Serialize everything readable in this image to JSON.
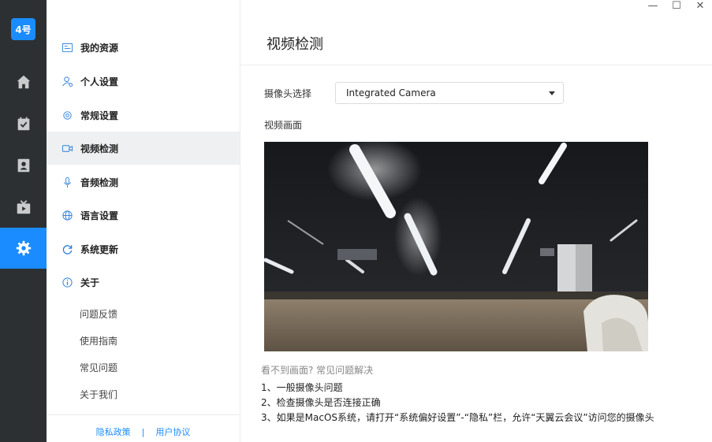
{
  "app": {
    "logo_text": "4号",
    "accent_color": "#1a8cff",
    "rail_bg": "#2d3033",
    "rail_items": [
      {
        "icon": "home-icon",
        "active": false
      },
      {
        "icon": "calendar-check-icon",
        "active": false
      },
      {
        "icon": "contacts-icon",
        "active": false
      },
      {
        "icon": "tv-icon",
        "active": false
      },
      {
        "icon": "gear-icon",
        "active": true
      }
    ]
  },
  "window_controls": {
    "minimize": "—",
    "maximize": "☐",
    "close": "✕"
  },
  "menu": {
    "items": [
      {
        "label": "我的资源",
        "icon": "id-card-icon"
      },
      {
        "label": "个人设置",
        "icon": "user-settings-icon"
      },
      {
        "label": "常规设置",
        "icon": "cog-icon"
      },
      {
        "label": "视频检测",
        "icon": "video-icon",
        "active": true
      },
      {
        "label": "音频检测",
        "icon": "microphone-icon"
      },
      {
        "label": "语言设置",
        "icon": "globe-icon"
      },
      {
        "label": "系统更新",
        "icon": "refresh-icon"
      },
      {
        "label": "关于",
        "icon": "info-icon"
      }
    ],
    "sub_items": [
      "问题反馈",
      "使用指南",
      "常见问题",
      "关于我们"
    ],
    "footer": {
      "privacy": "隐私政策",
      "separator": "|",
      "agreement": "用户协议"
    }
  },
  "main": {
    "title": "视频检测",
    "camera_label": "摄像头选择",
    "camera_selected": "Integrated Camera",
    "preview_label": "视频画面",
    "help_link": "看不到画面? 常见问题解决",
    "help_lines": [
      "1、一般摄像头问题",
      "2、检查摄像头是否连接正确",
      "3、如果是MacOS系统，请打开“系统偏好设置”-“隐私”栏，允许“天翼云会议”访问您的摄像头"
    ]
  }
}
